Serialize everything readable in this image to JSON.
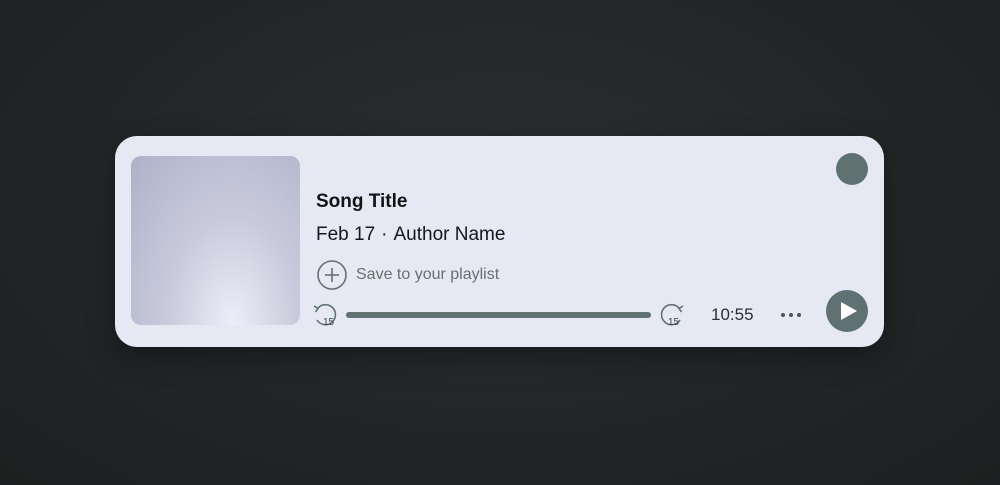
{
  "player": {
    "song_title": "Song Title",
    "date": "Feb 17",
    "separator": "·",
    "author": "Author Name",
    "save_label": "Save to your playlist",
    "skip_back_seconds": "15",
    "skip_forward_seconds": "15",
    "duration": "10:55",
    "progress_percent": 100,
    "icons": {
      "save": "plus-circle-icon",
      "skip_back": "rewind-15-icon",
      "skip_forward": "forward-15-icon",
      "more": "more-dots-icon",
      "play": "play-icon"
    },
    "colors": {
      "card_background": "#e6e9f3",
      "accent": "#5f7271",
      "page_background": "#232527"
    }
  }
}
